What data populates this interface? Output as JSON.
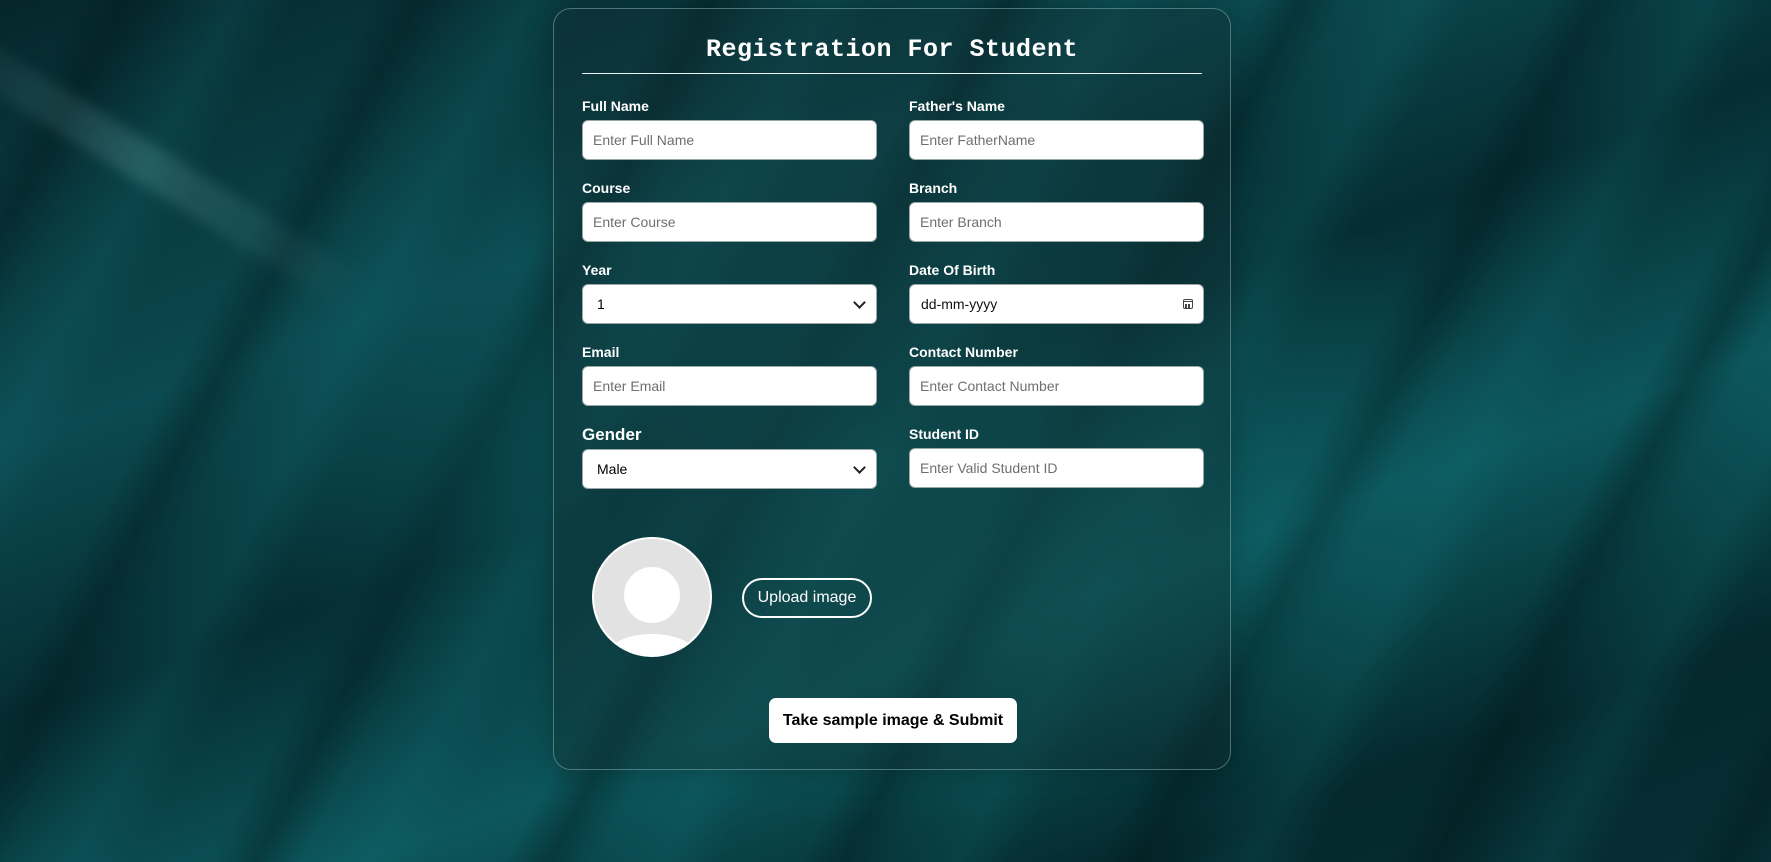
{
  "form": {
    "title": "Registration For Student",
    "fields": {
      "full_name": {
        "label": "Full Name",
        "placeholder": "Enter Full Name",
        "value": ""
      },
      "father_name": {
        "label": "Father's Name",
        "placeholder": "Enter FatherName",
        "value": ""
      },
      "course": {
        "label": "Course",
        "placeholder": "Enter Course",
        "value": ""
      },
      "branch": {
        "label": "Branch",
        "placeholder": "Enter Branch",
        "value": ""
      },
      "year": {
        "label": "Year",
        "selected": "1"
      },
      "dob": {
        "label": "Date Of Birth",
        "value": "dd-mm-yyyy",
        "icon": "calendar-icon"
      },
      "email": {
        "label": "Email",
        "placeholder": "Enter Email",
        "value": ""
      },
      "contact": {
        "label": "Contact Number",
        "placeholder": "Enter Contact Number",
        "value": ""
      },
      "gender": {
        "label": "Gender",
        "selected": "Male"
      },
      "student_id": {
        "label": "Student ID",
        "placeholder": "Enter Valid Student ID",
        "value": ""
      }
    },
    "avatar": {
      "icon": "user-avatar-placeholder-icon"
    },
    "upload_label": "Upload image",
    "submit_label": "Take sample image & Submit"
  },
  "colors": {
    "background": "#06343a",
    "card_border": "#96c8c8",
    "text": "#ffffff",
    "input_bg": "#ffffff",
    "placeholder": "#6f6f6f",
    "avatar_bg": "#e2e2e2"
  }
}
